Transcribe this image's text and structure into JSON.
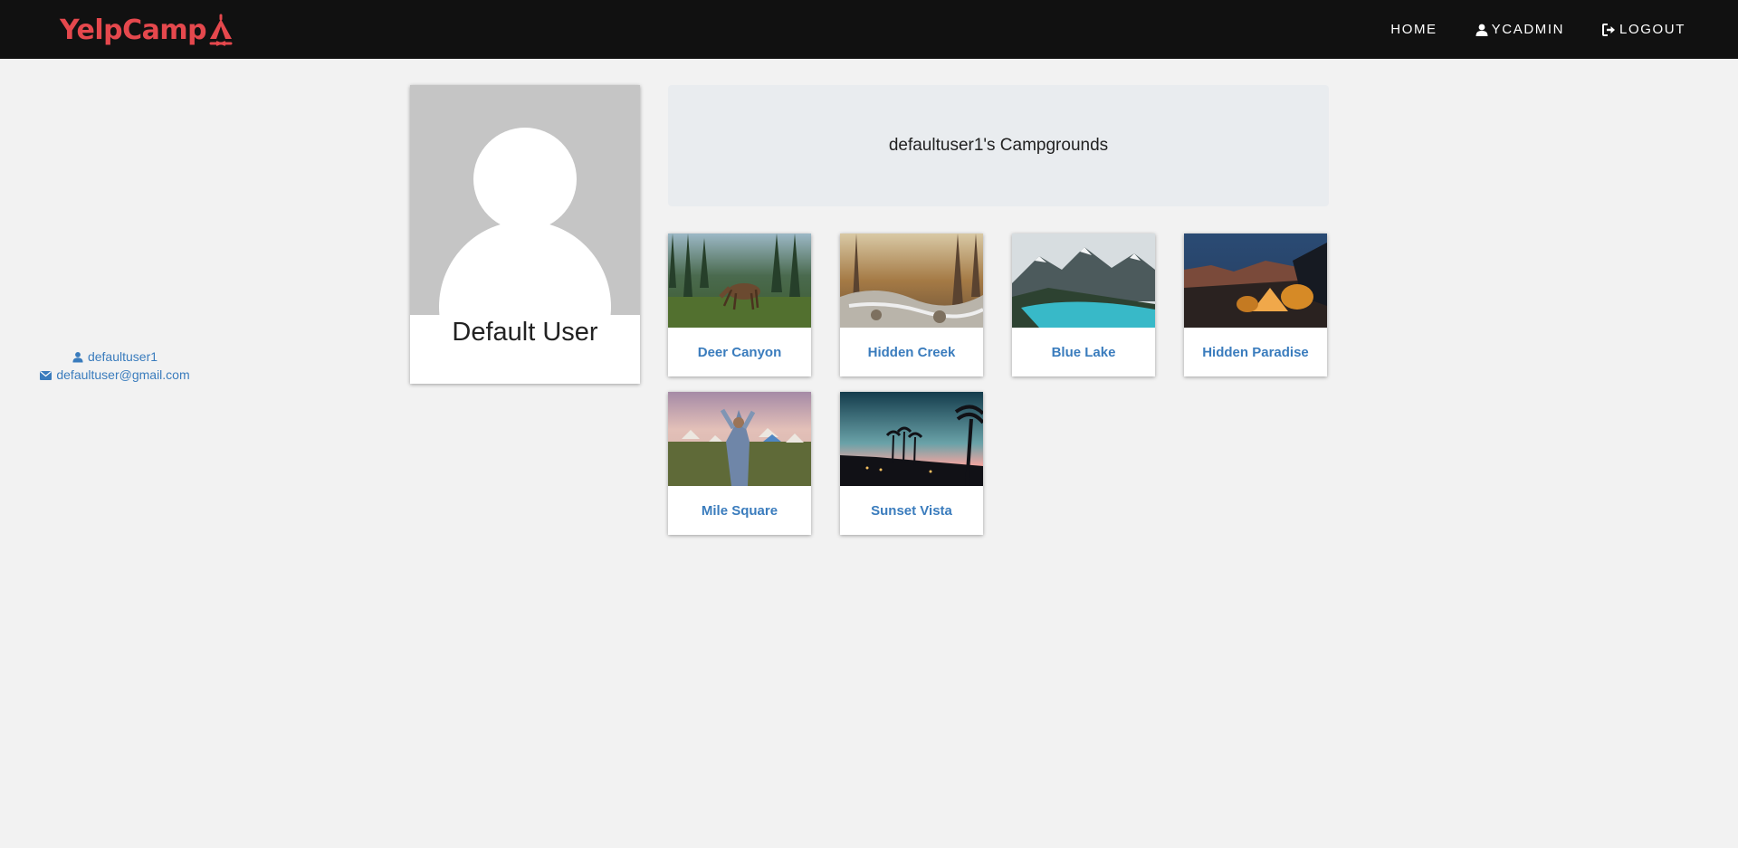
{
  "navbar": {
    "brand": "YelpCamp",
    "links": [
      {
        "label": "HOME",
        "icon": "none"
      },
      {
        "label": "YCADMIN",
        "icon": "user-icon"
      },
      {
        "label": "LOGOUT",
        "icon": "logout-icon"
      }
    ]
  },
  "profile": {
    "name": "Default User",
    "username": "defaultuser1",
    "email": "defaultuser@gmail.com"
  },
  "campgrounds_heading": "defaultuser1's Campgrounds",
  "campgrounds": [
    {
      "name": "Deer Canyon"
    },
    {
      "name": "Hidden Creek"
    },
    {
      "name": "Blue Lake"
    },
    {
      "name": "Hidden Paradise"
    },
    {
      "name": "Mile Square"
    },
    {
      "name": "Sunset Vista"
    }
  ],
  "colors": {
    "brand": "#e5484d",
    "navbar_bg": "#111111",
    "page_bg": "#f2f2f2",
    "link": "#3a7cbd",
    "jumbotron_bg": "#e9ecef"
  }
}
